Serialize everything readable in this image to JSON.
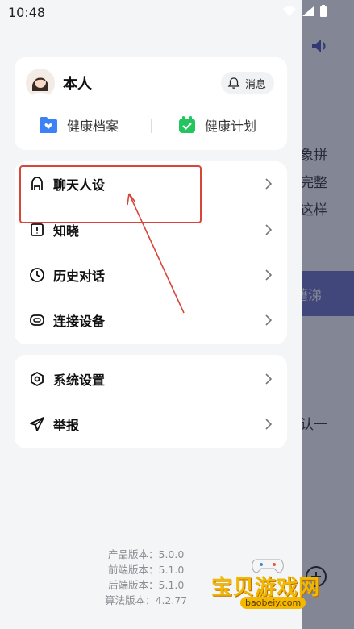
{
  "status_bar": {
    "time": "10:48"
  },
  "background": {
    "lines": [
      "象拼",
      "完整",
      "这样"
    ],
    "pill_text": "藉涕",
    "lower_text": "认一"
  },
  "profile": {
    "name": "本人",
    "message_label": "消息",
    "quick_links": [
      {
        "label": "健康档案",
        "icon": "health-record-icon",
        "color": "#3b82f6"
      },
      {
        "label": "健康计划",
        "icon": "health-plan-icon",
        "color": "#22c55e"
      }
    ]
  },
  "menu_group_1": [
    {
      "label": "聊天人设",
      "icon": "persona-icon"
    },
    {
      "label": "知晓",
      "icon": "notice-icon"
    },
    {
      "label": "历史对话",
      "icon": "history-icon"
    },
    {
      "label": "连接设备",
      "icon": "device-icon"
    }
  ],
  "menu_group_2": [
    {
      "label": "系统设置",
      "icon": "settings-icon"
    },
    {
      "label": "举报",
      "icon": "report-icon"
    }
  ],
  "versions": [
    "产品版本：5.0.0",
    "前端版本：5.1.0",
    "后端版本：5.1.0",
    "算法版本：4.2.77"
  ],
  "watermark": {
    "title": "宝贝游戏网",
    "url": "baobeiy.com"
  },
  "colors": {
    "annotation": "#d9453a",
    "accent_pill": "#6d73c8"
  }
}
